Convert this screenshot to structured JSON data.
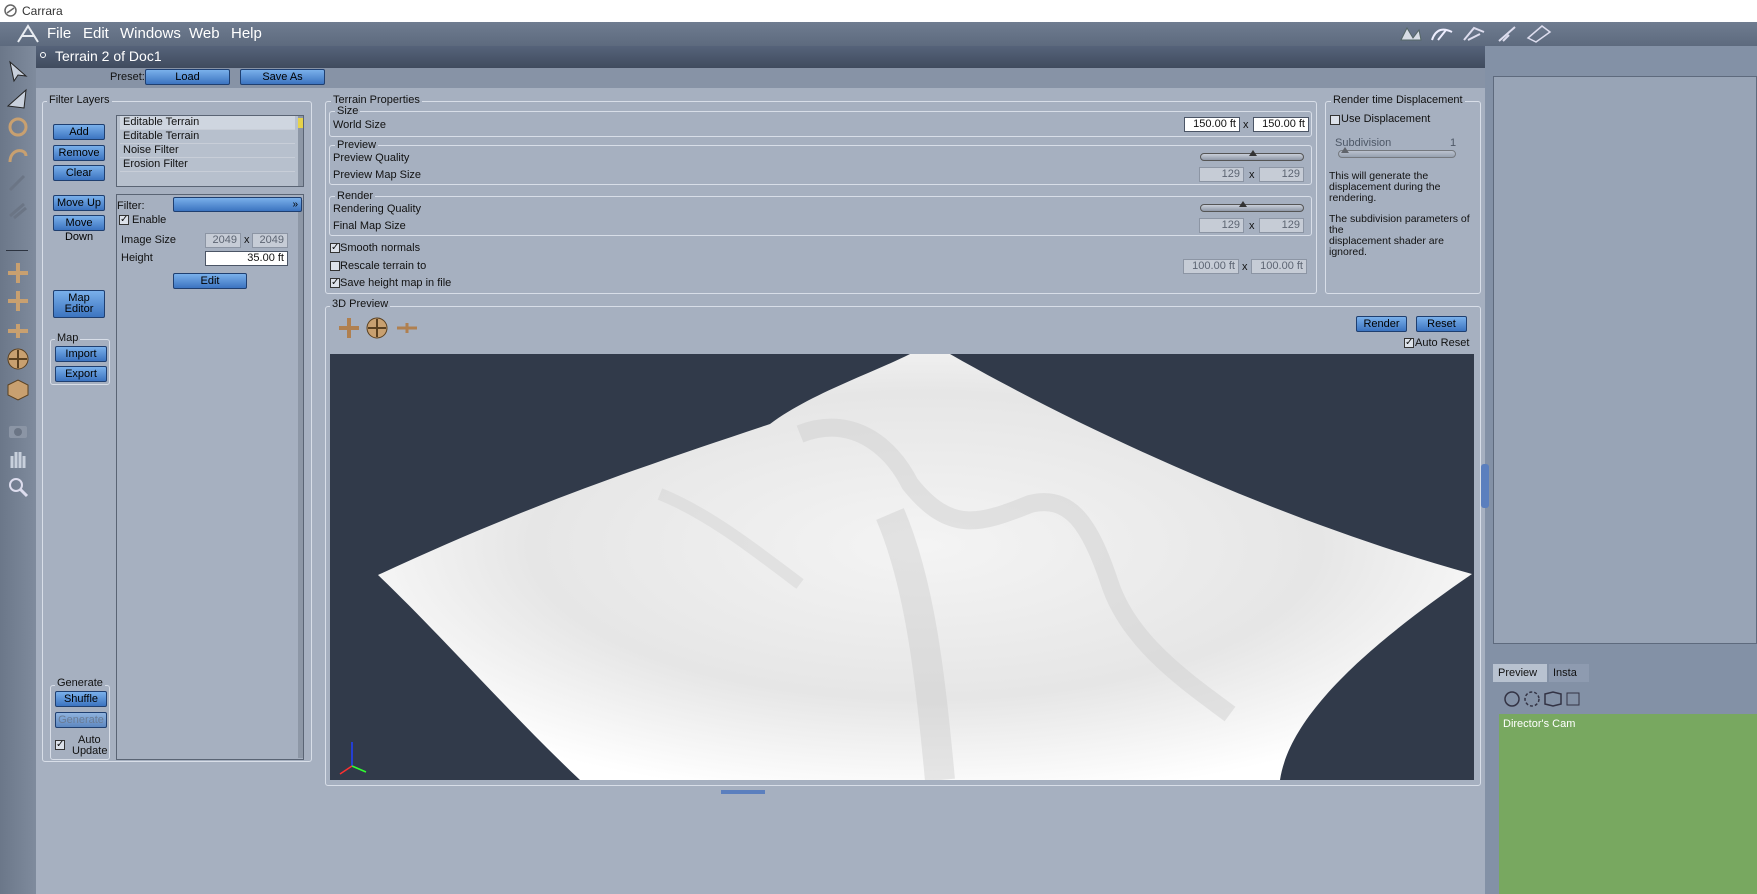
{
  "window": {
    "title": "Carrara"
  },
  "menu": {
    "items": [
      "File",
      "Edit",
      "Windows",
      "Web",
      "Help"
    ]
  },
  "document": {
    "title": "Terrain 2 of Doc1"
  },
  "preset": {
    "label": "Preset:",
    "load": "Load",
    "save_as": "Save As"
  },
  "filter_layers": {
    "title": "Filter Layers",
    "buttons": {
      "add": "Add",
      "remove": "Remove",
      "clear": "Clear",
      "move_up": "Move Up",
      "move_down": "Move Down",
      "map_editor_line1": "Map",
      "map_editor_line2": "Editor"
    },
    "layers": [
      "Editable Terrain",
      "Editable Terrain",
      "Noise Filter",
      "Erosion Filter"
    ],
    "filter_label": "Filter:",
    "enable_label": "Enable",
    "image_size_label": "Image Size",
    "image_size_w": "2049",
    "image_size_h": "2049",
    "x": "x",
    "height_label": "Height",
    "height_value": "35.00 ft",
    "edit": "Edit",
    "map": {
      "title": "Map",
      "import": "Import",
      "export": "Export"
    },
    "generate": {
      "title": "Generate",
      "shuffle": "Shuffle",
      "generate": "Generate",
      "auto_update_1": "Auto",
      "auto_update_2": "Update"
    }
  },
  "terrain_properties": {
    "title": "Terrain Properties",
    "size": {
      "title": "Size",
      "world_size_label": "World Size",
      "w": "150.00 ft",
      "h": "150.00 ft"
    },
    "preview": {
      "title": "Preview",
      "quality_label": "Preview Quality",
      "quality_level": 0.5,
      "map_size_label": "Preview Map Size",
      "map_w": "129",
      "map_h": "129"
    },
    "render": {
      "title": "Render",
      "quality_label": "Rendering Quality",
      "quality_level": 0.4,
      "map_size_label": "Final Map Size",
      "map_w": "129",
      "map_h": "129"
    },
    "smooth_normals": "Smooth normals",
    "rescale": "Rescale terrain to",
    "rescale_w": "100.00 ft",
    "rescale_h": "100.00 ft",
    "save_height": "Save height map in file"
  },
  "render_disp": {
    "title": "Render time Displacement",
    "use_label": "Use Displacement",
    "subdivision_label": "Subdivision",
    "subdivision_value": "1",
    "desc1": [
      "This will generate the",
      "displacement during the",
      "rendering."
    ],
    "desc2": [
      "The subdivision parameters of the",
      "displacement shader are ignored."
    ]
  },
  "preview3d": {
    "title": "3D Preview",
    "render": "Render",
    "reset": "Reset",
    "auto_reset": "Auto Reset"
  },
  "right_panel": {
    "tabs": [
      "Preview",
      "Insta"
    ],
    "camera": "Director's Cam"
  },
  "icons": {
    "app": "carrara-logo-icon",
    "toolbar_top": [
      "hand-tool-icon",
      "bone-tool-icon",
      "vertex-tool-icon",
      "brush-tool-icon",
      "ruler-tool-icon"
    ]
  }
}
